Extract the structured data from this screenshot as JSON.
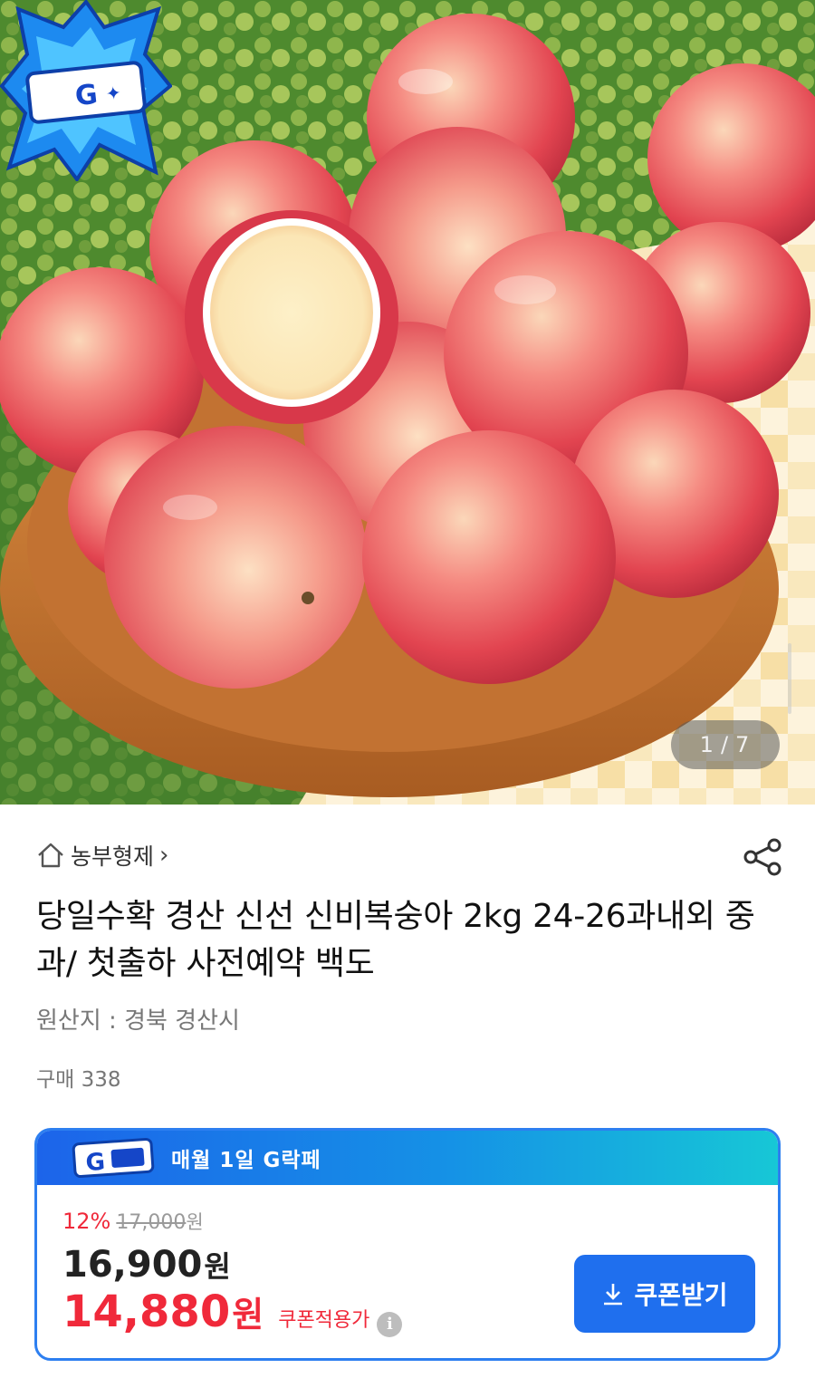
{
  "hero": {
    "page_current": "1",
    "page_separator": "/",
    "page_total": "7",
    "badge_icon": "g-rakpe-badge"
  },
  "store": {
    "icon": "home-icon",
    "name": "농부형제",
    "chevron": "›"
  },
  "product": {
    "title": "당일수확 경산 신선 신비복숭아 2kg 24-26과내외 중과/ 첫출하 사전예약 백도",
    "origin": "원산지 : 경북 경산시",
    "purchase_count": "구매 338"
  },
  "promo": {
    "banner_text": "매월 1일 G락페",
    "discount_rate": "12%",
    "original_price": "17,000",
    "original_unit": "원",
    "sale_price": "16,900",
    "sale_unit": "원",
    "coupon_price": "14,880",
    "coupon_unit": "원",
    "coupon_label": "쿠폰적용가",
    "info_glyph": "i",
    "coupon_button_label": "쿠폰받기"
  },
  "colors": {
    "accent_blue": "#1f6fee",
    "price_red": "#f0293a",
    "promo_gradient_start": "#1c64ea",
    "promo_gradient_end": "#17c7d6"
  }
}
